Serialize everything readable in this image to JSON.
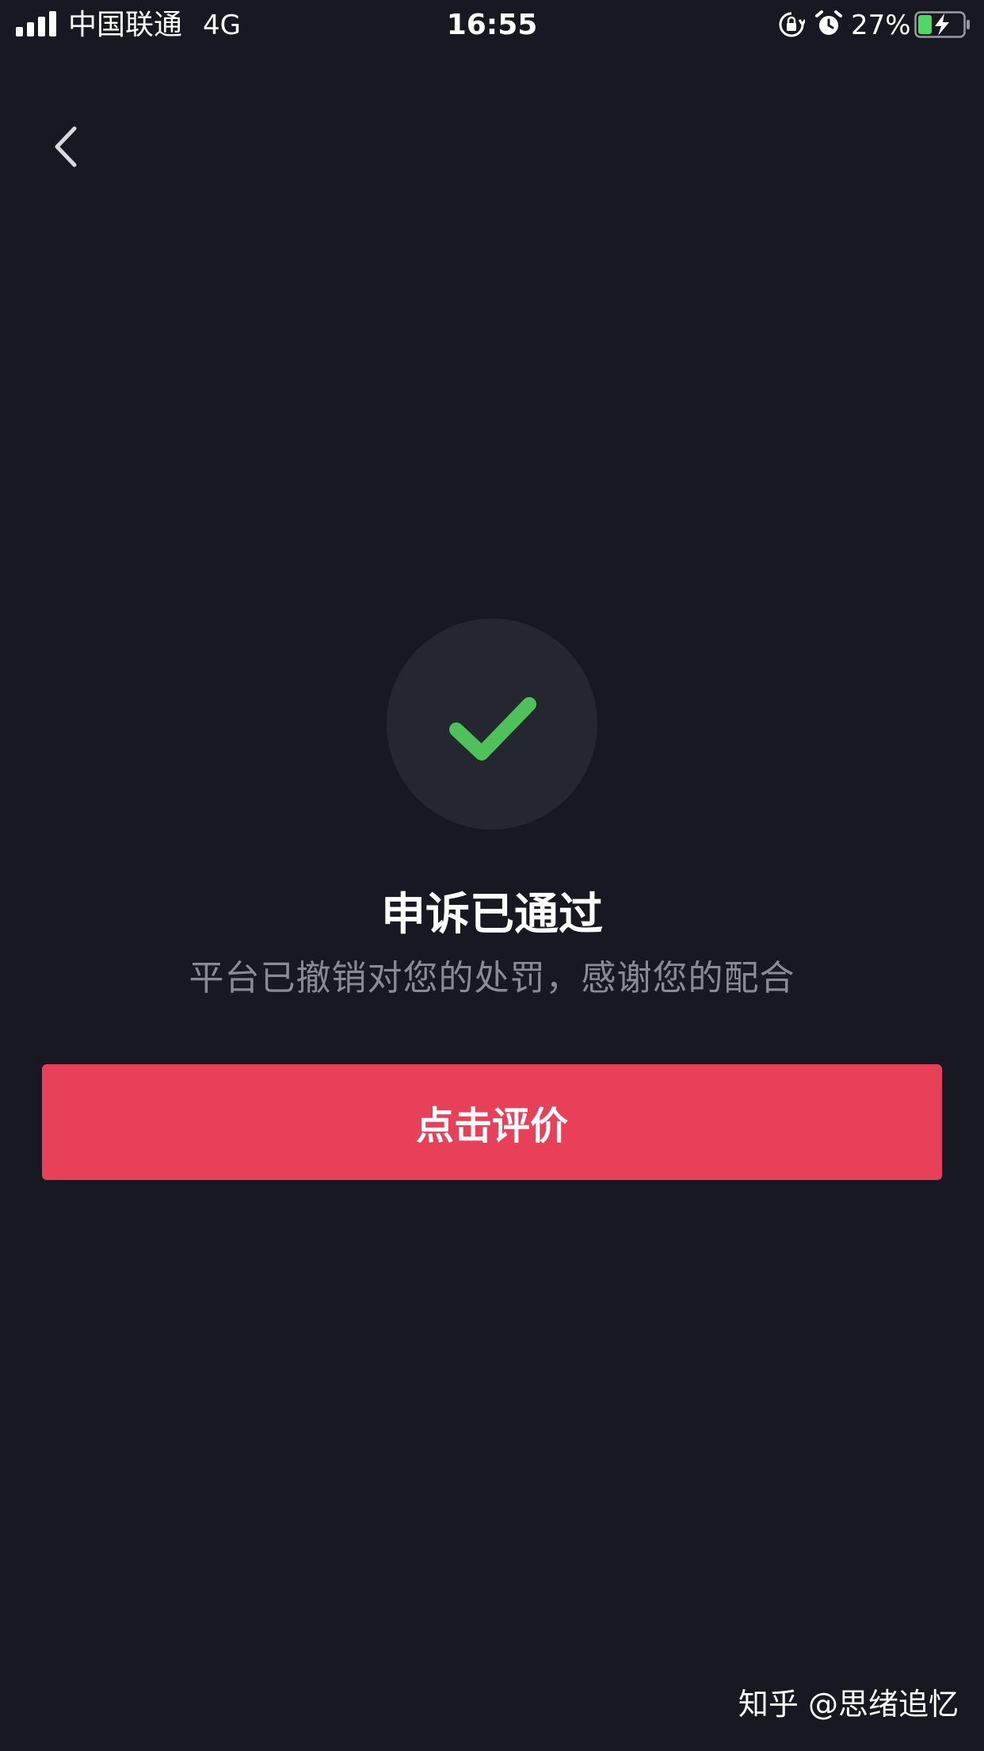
{
  "status_bar": {
    "carrier": "中国联通",
    "network": "4G",
    "time": "16:55",
    "battery_percent": "27%",
    "icons": [
      "signal-icon",
      "rotation-lock-icon",
      "alarm-icon",
      "battery-charging-icon"
    ]
  },
  "nav": {
    "back_icon": "chevron-left-icon"
  },
  "result": {
    "icon": "checkmark-icon",
    "title": "申诉已通过",
    "message": "平台已撤销对您的处罚，感谢您的配合"
  },
  "actions": {
    "rate_label": "点击评价"
  },
  "watermark": "知乎 @思绪追忆",
  "colors": {
    "background": "#181823",
    "accent": "#e84059",
    "success": "#4fc15a",
    "circle": "#252730",
    "subtext": "#8a8b92"
  }
}
